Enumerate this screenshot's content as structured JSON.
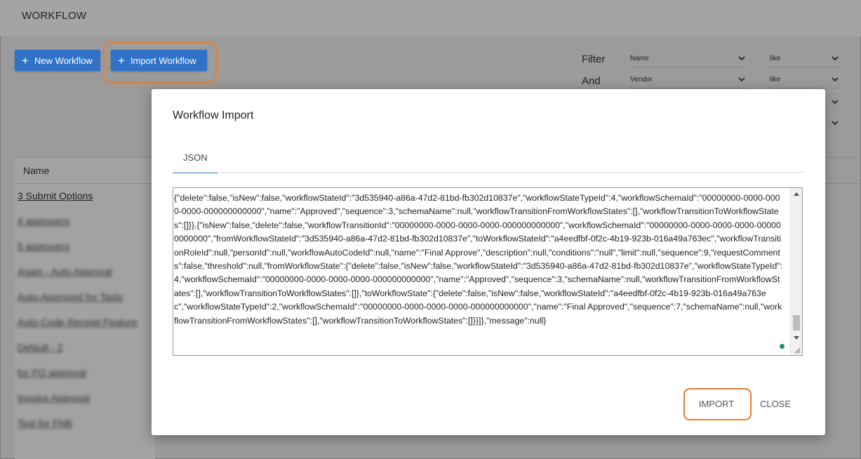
{
  "app": {
    "title": "WORKFLOW"
  },
  "toolbar": {
    "new_workflow_label": "New Workflow",
    "import_workflow_label": "Import Workflow"
  },
  "filters": {
    "filter_label": "Filter",
    "and_label": "And",
    "rows": [
      {
        "field": "Name",
        "operator": "like"
      },
      {
        "field": "Vendor",
        "operator": "like"
      }
    ]
  },
  "table": {
    "column_name": "Name",
    "rows": [
      "3 Submit Options",
      "4 approvers",
      "5 approvers",
      "Again - Auto Approval",
      "Auto-Approved for Taxlo",
      "Auto-Code Receipt Feature",
      "Default - 2",
      "for PO approval",
      "Invoice Approval",
      "Test for FNB"
    ]
  },
  "modal": {
    "title": "Workflow Import",
    "tab_json": "JSON",
    "json_text": "{\"delete\":false,\"isNew\":false,\"workflowStateId\":\"3d535940-a86a-47d2-81bd-fb302d10837e\",\"workflowStateTypeId\":4,\"workflowSchemaId\":\"00000000-0000-0000-0000-000000000000\",\"name\":\"Approved\",\"sequence\":3,\"schemaName\":null,\"workflowTransitionFromWorkflowStates\":[],\"workflowTransitionToWorkflowStates\":[]}},{\"isNew\":false,\"delete\":false,\"workflowTransitionId\":\"00000000-0000-0000-0000-000000000000\",\"workflowSchemaId\":\"00000000-0000-0000-0000-000000000000\",\"fromWorkflowStateId\":\"3d535940-a86a-47d2-81bd-fb302d10837e\",\"toWorkflowStateId\":\"a4eedfbf-0f2c-4b19-923b-016a49a763ec\",\"workflowTransitionRoleId\":null,\"personId\":null,\"workflowAutoCodeId\":null,\"name\":\"Final Approve\",\"description\":null,\"conditions\":\"null\",\"limit\":null,\"sequence\":9,\"requestComments\":false,\"threshold\":null,\"fromWorkflowState\":{\"delete\":false,\"isNew\":false,\"workflowStateId\":\"3d535940-a86a-47d2-81bd-fb302d10837e\",\"workflowStateTypeId\":4,\"workflowSchemaId\":\"00000000-0000-0000-0000-000000000000\",\"name\":\"Approved\",\"sequence\":3,\"schemaName\":null,\"workflowTransitionFromWorkflowStates\":[],\"workflowTransitionToWorkflowStates\":[]},\"toWorkflowState\":{\"delete\":false,\"isNew\":false,\"workflowStateId\":\"a4eedfbf-0f2c-4b19-923b-016a49a763ec\",\"workflowStateTypeId\":2,\"workflowSchemaId\":\"00000000-0000-0000-0000-000000000000\",\"name\":\"Final Approved\",\"sequence\":7,\"schemaName\":null,\"workflowTransitionFromWorkflowStates\":[],\"workflowTransitionToWorkflowStates\":[]}}]},\"message\":null}",
    "import_label": "IMPORT",
    "close_label": "CLOSE"
  },
  "colors": {
    "accent": "#2f72c7",
    "highlight": "#e97d2b",
    "tab_underline": "#3a8bd6"
  },
  "icons": [
    "plus-icon",
    "chevron-down-icon",
    "resize-grip-icon",
    "status-dot-icon"
  ]
}
